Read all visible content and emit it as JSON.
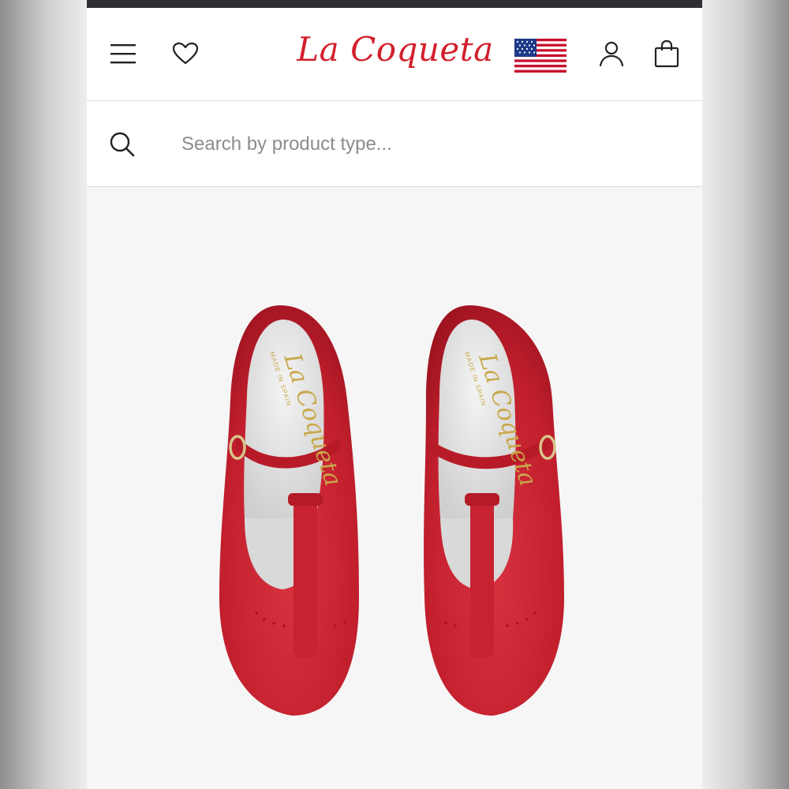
{
  "header": {
    "brand": "La Coqueta",
    "icons": [
      "hamburger-menu-icon",
      "heart-icon",
      "user-icon",
      "shopping-bag-icon"
    ],
    "brand_color": "#d21f2c"
  },
  "search": {
    "placeholder": "Search by product type...",
    "value": ""
  },
  "product": {
    "insole_brand": "La Coqueta",
    "insole_tagline": "MADE IN SPAIN",
    "shoe_color": "#cc2230"
  }
}
